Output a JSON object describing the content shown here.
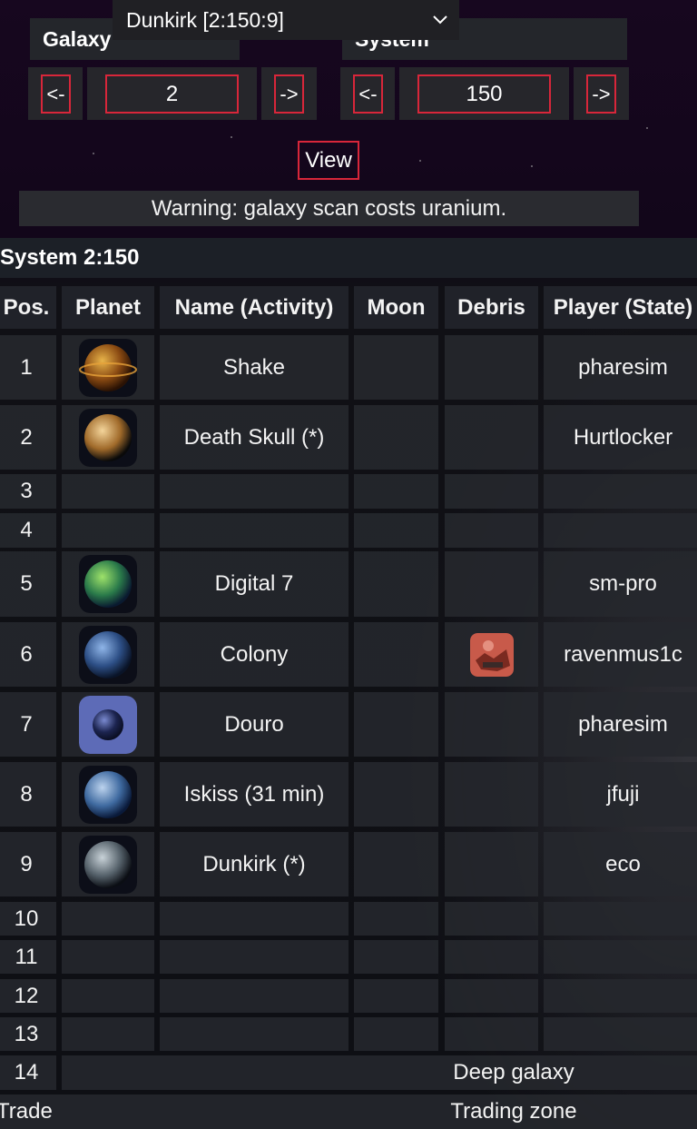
{
  "selector": {
    "current_planet": "Dunkirk [2:150:9]"
  },
  "galaxy": {
    "label": "Galaxy",
    "prev": "<-",
    "value": "2",
    "next": "->"
  },
  "system": {
    "label": "System",
    "prev": "<-",
    "value": "150",
    "next": "->"
  },
  "view_button": "View",
  "warning": "Warning: galaxy scan costs uranium.",
  "system_title": "System 2:150",
  "table": {
    "headers": [
      "Pos.",
      "Planet",
      "Name (Activity)",
      "Moon",
      "Debris",
      "Player (State)"
    ],
    "rows": [
      {
        "pos": "1",
        "planet_icon": "gas-giant-planet-icon",
        "name": "Shake",
        "moon": "",
        "debris": "",
        "player": "pharesim"
      },
      {
        "pos": "2",
        "planet_icon": "desert-planet-icon",
        "name": "Death Skull (*)",
        "moon": "",
        "debris": "",
        "player": "Hurtlocker"
      },
      {
        "pos": "3",
        "planet_icon": "",
        "name": "",
        "moon": "",
        "debris": "",
        "player": ""
      },
      {
        "pos": "4",
        "planet_icon": "",
        "name": "",
        "moon": "",
        "debris": "",
        "player": ""
      },
      {
        "pos": "5",
        "planet_icon": "jungle-planet-icon",
        "name": "Digital 7",
        "moon": "",
        "debris": "",
        "player": "sm-pro"
      },
      {
        "pos": "6",
        "planet_icon": "earth-planet-icon",
        "name": "Colony",
        "moon": "",
        "debris": "debris-field-icon",
        "player": "ravenmus1c"
      },
      {
        "pos": "7",
        "planet_icon": "dark-planet-icon",
        "name": "Douro",
        "moon": "",
        "debris": "",
        "player": "pharesim"
      },
      {
        "pos": "8",
        "planet_icon": "ice-planet-icon",
        "name": "Iskiss (31 min)",
        "moon": "",
        "debris": "",
        "player": "jfuji"
      },
      {
        "pos": "9",
        "planet_icon": "rocky-planet-icon",
        "name": "Dunkirk (*)",
        "moon": "",
        "debris": "",
        "player": "eco"
      },
      {
        "pos": "10",
        "planet_icon": "",
        "name": "",
        "moon": "",
        "debris": "",
        "player": ""
      },
      {
        "pos": "11",
        "planet_icon": "",
        "name": "",
        "moon": "",
        "debris": "",
        "player": ""
      },
      {
        "pos": "12",
        "planet_icon": "",
        "name": "",
        "moon": "",
        "debris": "",
        "player": ""
      },
      {
        "pos": "13",
        "planet_icon": "",
        "name": "",
        "moon": "",
        "debris": "",
        "player": ""
      }
    ],
    "special_rows": [
      {
        "label": "14",
        "value": "Deep galaxy"
      },
      {
        "label": "Trade",
        "value": "Trading zone"
      }
    ]
  },
  "colors": {
    "accent_border": "#d8263a",
    "cell_bg": "#26282d",
    "background": "#12061a"
  }
}
